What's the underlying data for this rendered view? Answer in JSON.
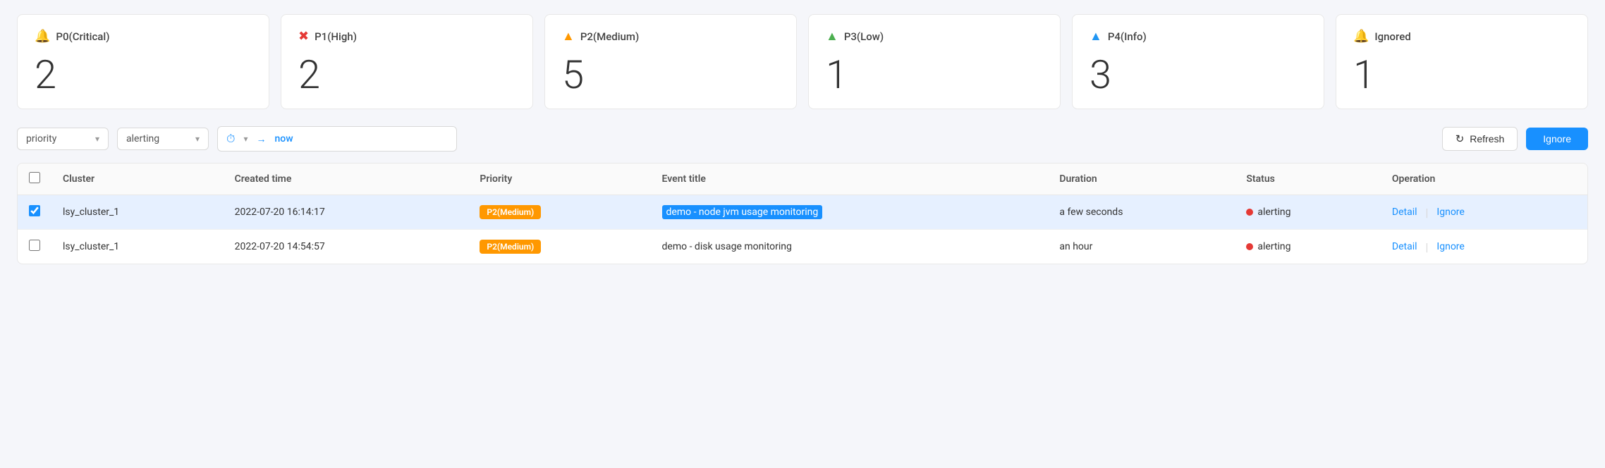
{
  "priority_cards": [
    {
      "id": "p0",
      "icon": "🔔",
      "icon_class": "icon-critical",
      "label": "P0(Critical)",
      "count": "2"
    },
    {
      "id": "p1",
      "icon": "✖",
      "icon_class": "icon-high",
      "label": "P1(High)",
      "count": "2"
    },
    {
      "id": "p2",
      "icon": "▲",
      "icon_class": "icon-medium",
      "label": "P2(Medium)",
      "count": "5"
    },
    {
      "id": "p3",
      "icon": "▲",
      "icon_class": "icon-low",
      "label": "P3(Low)",
      "count": "1"
    },
    {
      "id": "p4",
      "icon": "▲",
      "icon_class": "icon-info",
      "label": "P4(Info)",
      "count": "3"
    },
    {
      "id": "ignored",
      "icon": "🔔",
      "icon_class": "icon-ignored",
      "label": "Ignored",
      "count": "1"
    }
  ],
  "toolbar": {
    "filter_priority_label": "priority",
    "filter_status_label": "alerting",
    "time_placeholder": "now",
    "refresh_label": "Refresh",
    "ignore_label": "Ignore"
  },
  "table": {
    "columns": [
      "",
      "Cluster",
      "Created time",
      "Priority",
      "Event title",
      "Duration",
      "Status",
      "Operation"
    ],
    "rows": [
      {
        "id": "row1",
        "selected": true,
        "cluster": "lsy_cluster_1",
        "created_time": "2022-07-20 16:14:17",
        "priority": "P2(Medium)",
        "event_title": "demo - node jvm usage monitoring",
        "duration": "a few seconds",
        "status": "alerting",
        "op_detail": "Detail",
        "op_ignore": "Ignore"
      },
      {
        "id": "row2",
        "selected": false,
        "cluster": "lsy_cluster_1",
        "created_time": "2022-07-20 14:54:57",
        "priority": "P2(Medium)",
        "event_title": "demo - disk usage monitoring",
        "duration": "an hour",
        "status": "alerting",
        "op_detail": "Detail",
        "op_ignore": "Ignore"
      }
    ]
  }
}
